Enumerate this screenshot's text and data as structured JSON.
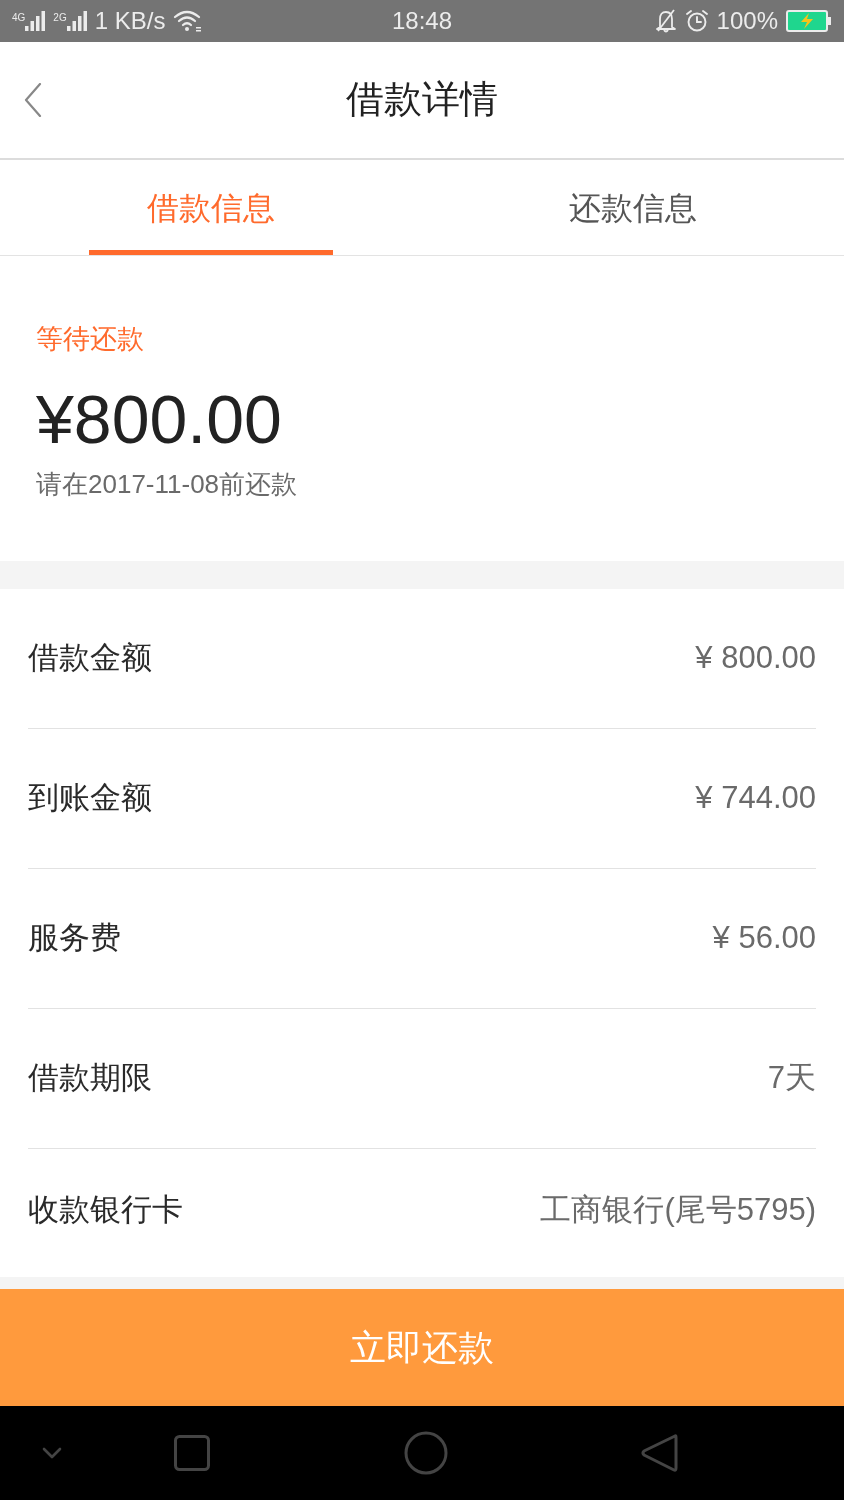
{
  "status_bar": {
    "signals": [
      {
        "network": "4G"
      },
      {
        "network": "2G"
      }
    ],
    "speed": "1 KB/s",
    "time": "18:48",
    "battery": "100%"
  },
  "header": {
    "title": "借款详情"
  },
  "tabs": [
    {
      "label": "借款信息",
      "selected": true
    },
    {
      "label": "还款信息",
      "selected": false
    }
  ],
  "summary": {
    "status": "等待还款",
    "amount": "¥800.00",
    "due_note": "请在2017-11-08前还款"
  },
  "details": [
    {
      "label": "借款金额",
      "value": "¥ 800.00"
    },
    {
      "label": "到账金额",
      "value": "¥ 744.00"
    },
    {
      "label": "服务费",
      "value": "¥ 56.00"
    },
    {
      "label": "借款期限",
      "value": "7天"
    },
    {
      "label": "收款银行卡",
      "value": "工商银行(尾号5795)"
    }
  ],
  "primary_button": {
    "label": "立即还款"
  }
}
